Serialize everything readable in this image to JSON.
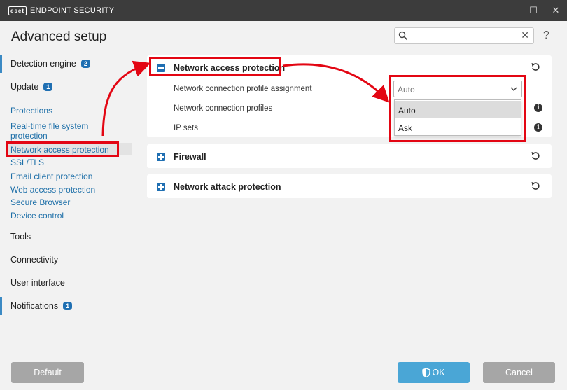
{
  "titlebar": {
    "logo_text": "eset",
    "product": "ENDPOINT SECURITY",
    "minimize_glyph": "—",
    "maximize_glyph": "☐",
    "close_glyph": "✕"
  },
  "header": {
    "title": "Advanced setup",
    "search_placeholder": "",
    "search_value": "",
    "help_glyph": "?"
  },
  "sidebar": {
    "detection": {
      "label": "Detection engine",
      "badge": "2"
    },
    "update": {
      "label": "Update",
      "badge": "1"
    },
    "protections": [
      "Protections",
      "Real-time file system protection",
      "Network access protection",
      "SSL/TLS",
      "Email client protection",
      "Web access protection",
      "Secure Browser",
      "Device control"
    ],
    "tools": "Tools",
    "connectivity": "Connectivity",
    "user_interface": "User interface",
    "notifications": {
      "label": "Notifications",
      "badge": "1"
    }
  },
  "main": {
    "network_access": {
      "title": "Network access protection",
      "expanded": true,
      "settings": [
        "Network connection profile assignment",
        "Network connection profiles",
        "IP sets"
      ],
      "profile_assignment_value": "Auto",
      "dropdown_options": [
        "Auto",
        "Ask"
      ],
      "highlighted_option": "Auto"
    },
    "firewall": {
      "title": "Firewall",
      "expanded": false
    },
    "network_attack": {
      "title": "Network attack protection",
      "expanded": false
    }
  },
  "footer": {
    "default_label": "Default",
    "ok_label": "OK",
    "cancel_label": "Cancel"
  },
  "colors": {
    "accent_blue": "#1f6fb2",
    "link_blue": "#1d6fa8",
    "callout_red": "#e30613",
    "ok_button": "#4aa6d6",
    "grey_button": "#a6a6a6"
  },
  "icons": [
    "search-icon",
    "close-icon",
    "help-icon",
    "collapse-icon",
    "expand-icon",
    "reset-icon",
    "info-icon",
    "chevron-down-icon",
    "shield-icon"
  ]
}
